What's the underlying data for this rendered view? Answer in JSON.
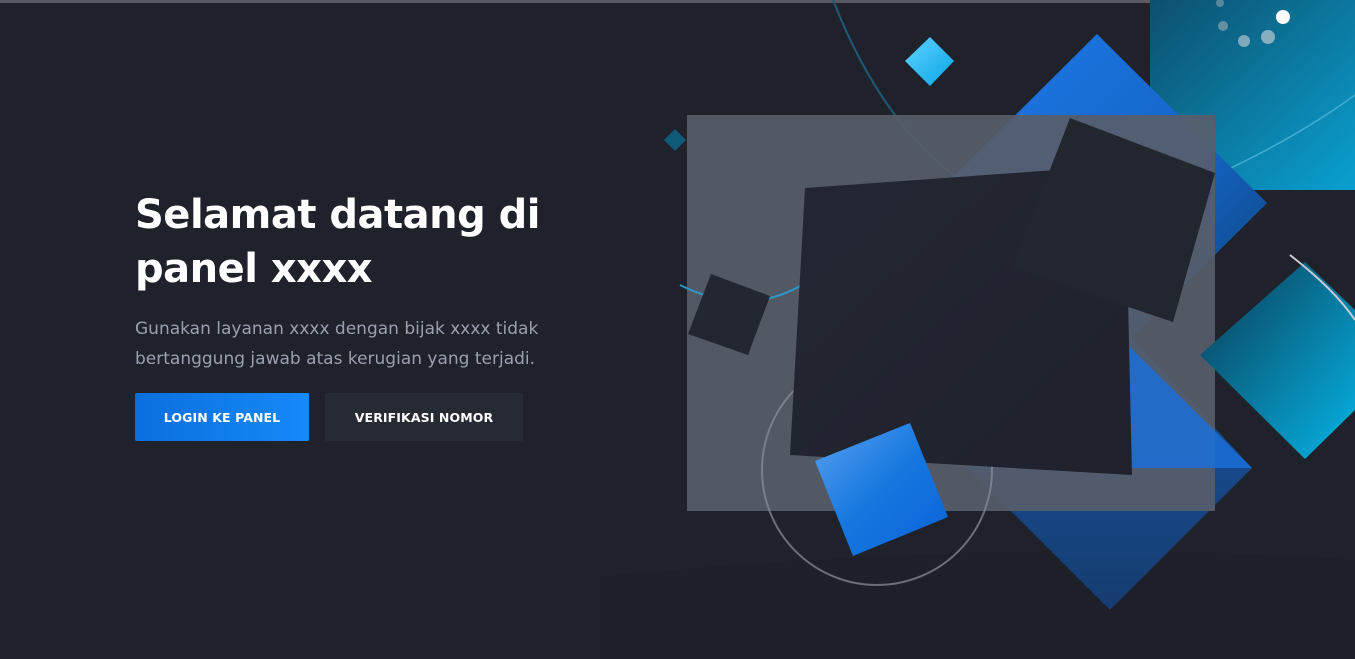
{
  "hero": {
    "title": "Selamat datang di panel xxxx",
    "subtitle": "Gunakan layanan xxxx dengan bijak xxxx tidak bertanggung jawab atas kerugian yang terjadi."
  },
  "buttons": {
    "login_label": "LOGIN KE PANEL",
    "verify_label": "VERIFIKASI NOMOR"
  },
  "colors": {
    "background": "#1f222b",
    "accent": "#1689f8",
    "secondary_button": "#262a33"
  },
  "illustration": {
    "icon": "abstract-geometric-shapes"
  }
}
